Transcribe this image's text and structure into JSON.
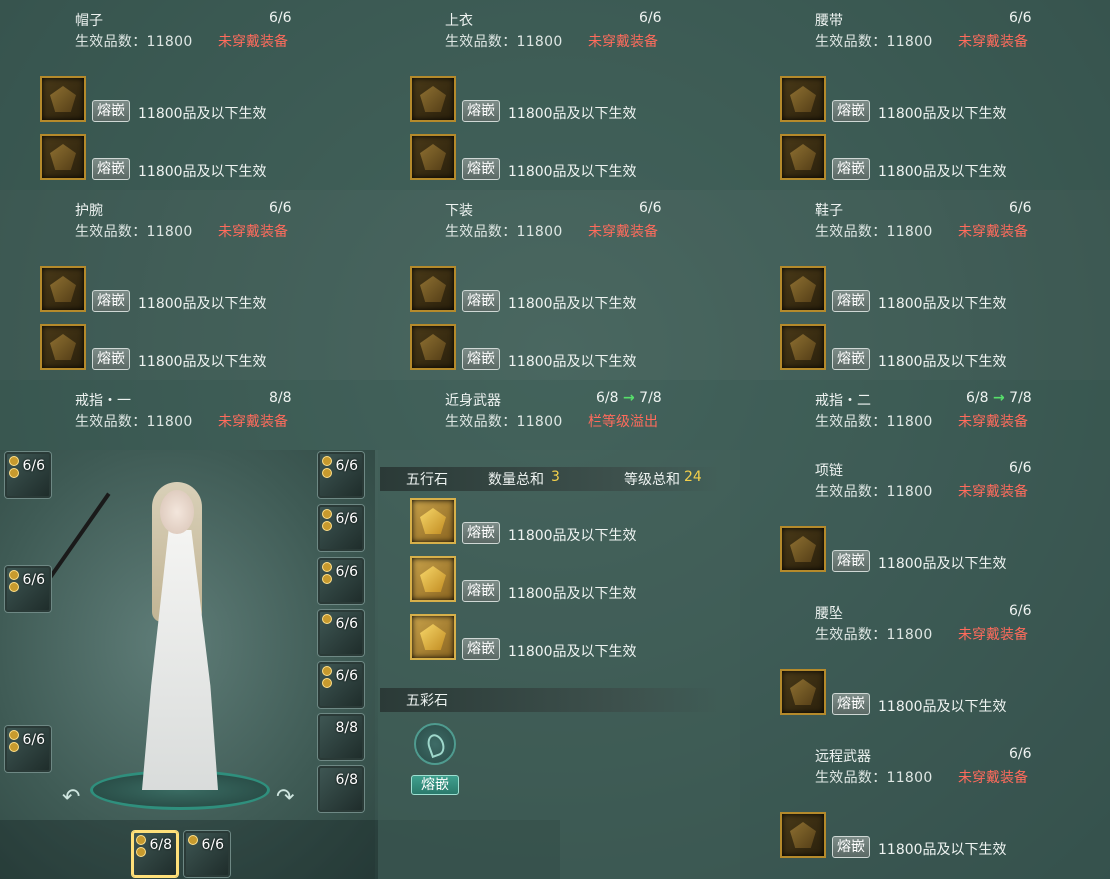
{
  "common": {
    "eff_label": "生效品数：11800",
    "warn_label": "未穿戴装备",
    "inlay_label": "熔嵌",
    "gem_text": "11800品及以下生效"
  },
  "cells": [
    {
      "name": "帽子",
      "count": "6/6"
    },
    {
      "name": "上衣",
      "count": "6/6"
    },
    {
      "name": "腰带",
      "count": "6/6"
    },
    {
      "name": "护腕",
      "count": "6/6"
    },
    {
      "name": "下装",
      "count": "6/6"
    },
    {
      "name": "鞋子",
      "count": "6/6"
    },
    {
      "name": "戒指・一",
      "count": "8/8"
    },
    {
      "name": "近身武器",
      "count": "6/8",
      "upgrade": "7/8",
      "status": "栏等级溢出"
    },
    {
      "name": "戒指・二",
      "count": "6/8",
      "upgrade": "7/8"
    },
    {
      "name": "项链",
      "count": "6/6"
    },
    {
      "name": "腰坠",
      "count": "6/6"
    },
    {
      "name": "远程武器",
      "count": "6/6"
    }
  ],
  "equip_slots": {
    "left": [
      "6/6",
      "6/6",
      "6/6"
    ],
    "right": [
      "6/6",
      "6/6",
      "6/6",
      "6/6",
      "6/6",
      "8/8",
      "6/8"
    ],
    "bottom": [
      "6/8",
      "6/6"
    ]
  },
  "wuxing": {
    "title": "五行石",
    "count_label": "数量总和",
    "count_value": "3",
    "level_label": "等级总和",
    "level_value": "24"
  },
  "wucai": {
    "title": "五彩石",
    "button": "熔嵌"
  },
  "icons": {
    "arrow": "→",
    "rotate_left": "↶",
    "rotate_right": "↷"
  },
  "colors": {
    "warn": "#ff6b5c",
    "highlight": "#f3d04b",
    "arrow": "#57e06a"
  }
}
